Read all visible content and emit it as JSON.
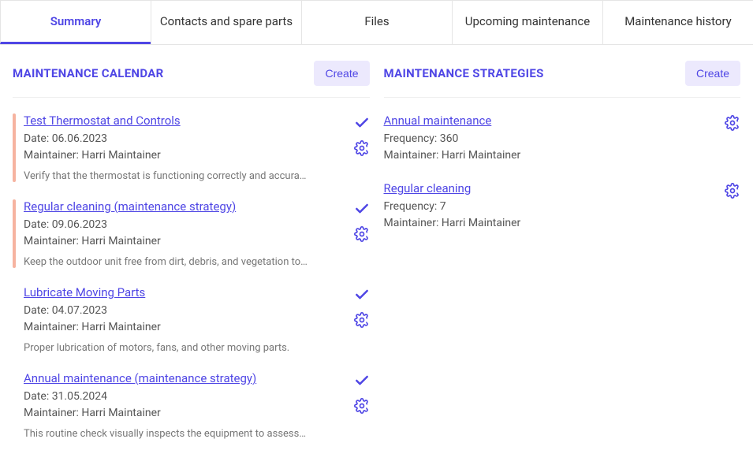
{
  "tabs": [
    {
      "label": "Summary",
      "active": true
    },
    {
      "label": "Contacts and spare parts",
      "active": false
    },
    {
      "label": "Files",
      "active": false
    },
    {
      "label": "Upcoming maintenance",
      "active": false
    },
    {
      "label": "Maintenance history",
      "active": false
    }
  ],
  "calendar": {
    "title": "MAINTENANCE CALENDAR",
    "create_label": "Create",
    "date_label": "Date",
    "maintainer_label": "Maintainer",
    "items": [
      {
        "title": "Test Thermostat and Controls",
        "date": "06.06.2023",
        "maintainer": "Harri Maintainer",
        "desc": "Verify that the thermostat is functioning correctly and accurately reads the temperature.",
        "accent": true
      },
      {
        "title": "Regular cleaning (maintenance strategy)",
        "date": "09.06.2023",
        "maintainer": "Harri Maintainer",
        "desc": "Keep the outdoor unit free from dirt, debris, and vegetation to ensure airflow.",
        "accent": true
      },
      {
        "title": "Lubricate Moving Parts",
        "date": "04.07.2023",
        "maintainer": "Harri Maintainer",
        "desc": "Proper lubrication of motors, fans, and other moving parts.",
        "accent": false
      },
      {
        "title": "Annual maintenance (maintenance strategy)",
        "date": "31.05.2024",
        "maintainer": "Harri Maintainer",
        "desc": "This routine check visually inspects the equipment to assess the overall condition.",
        "accent": false
      }
    ]
  },
  "strategies": {
    "title": "MAINTENANCE STRATEGIES",
    "create_label": "Create",
    "frequency_label": "Frequency",
    "maintainer_label": "Maintainer",
    "items": [
      {
        "title": "Annual maintenance",
        "frequency": "360",
        "maintainer": "Harri Maintainer"
      },
      {
        "title": "Regular cleaning",
        "frequency": "7",
        "maintainer": "Harri Maintainer"
      }
    ]
  }
}
